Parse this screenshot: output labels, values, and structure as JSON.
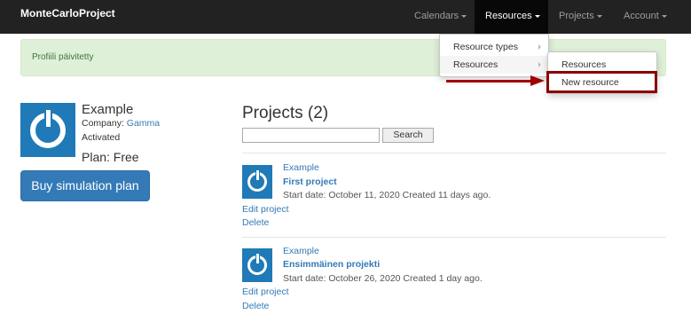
{
  "navbar": {
    "brand": "MonteCarloProject",
    "items": [
      {
        "label": "Calendars"
      },
      {
        "label": "Resources"
      },
      {
        "label": "Projects"
      },
      {
        "label": "Account"
      }
    ]
  },
  "alert": {
    "message": "Profiili päivitetty"
  },
  "resources_menu": {
    "items": [
      {
        "label": "Resource types"
      },
      {
        "label": "Resources"
      }
    ]
  },
  "resources_submenu": {
    "items": [
      {
        "label": "Resources"
      },
      {
        "label": "New resource"
      }
    ]
  },
  "profile": {
    "name": "Example",
    "company_label": "Company:",
    "company": "Gamma",
    "status": "Activated",
    "plan": "Plan: Free",
    "buy_button": "Buy simulation plan"
  },
  "projects": {
    "title": "Projects (2)",
    "search_button": "Search",
    "search_value": "",
    "list": [
      {
        "owner": "Example",
        "title": "First project",
        "meta": "Start date: October 11, 2020 Created 11 days ago.",
        "edit": "Edit project",
        "delete": "Delete"
      },
      {
        "owner": "Example",
        "title": "Ensimmäinen projekti",
        "meta": "Start date: October 26, 2020 Created 1 day ago.",
        "edit": "Edit project",
        "delete": "Delete"
      }
    ]
  },
  "colors": {
    "navbar": "#222222",
    "accent": "#337ab7",
    "alert_bg": "#dff0d8",
    "highlight": "#8b0000"
  }
}
